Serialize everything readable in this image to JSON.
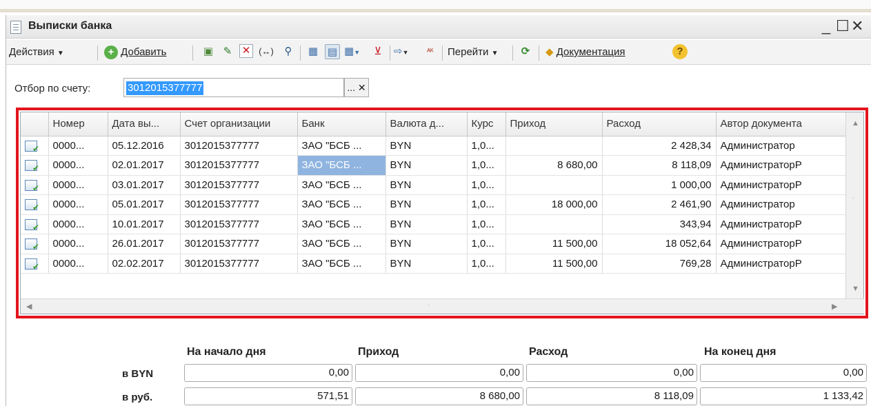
{
  "window": {
    "title": "Выписки банка",
    "controls": [
      "_",
      "☐",
      "✕"
    ]
  },
  "toolbar": {
    "actions_label": "Действия",
    "add_label": "Добавить",
    "goto_label": "Перейти",
    "docs_label": "Документация",
    "icons": [
      "copy-icon",
      "edit-icon",
      "delete-icon",
      "link-icon",
      "find-icon",
      "filter-icon",
      "filter-active-icon",
      "filter-menu-icon",
      "filter-clear-icon",
      "export-icon",
      "dt-kt-icon",
      "refresh-icon",
      "docs-icon",
      "help-icon"
    ]
  },
  "filter": {
    "label": "Отбор по счету:",
    "value": "3012015377777",
    "select_button": "...",
    "clear_button": "✕"
  },
  "table": {
    "columns": [
      "Номер",
      "Дата вы...",
      "Счет организации",
      "Банк",
      "Валюта д...",
      "Курс",
      "Приход",
      "Расход",
      "Автор документа"
    ],
    "rows": [
      {
        "number": "0000...",
        "date": "05.12.2016",
        "account": "3012015377777",
        "bank": "ЗАО \"БСБ ...",
        "currency": "BYN",
        "rate": "1,0...",
        "income": "",
        "expense": "2 428,34",
        "author": "Администратор"
      },
      {
        "number": "0000...",
        "date": "02.01.2017",
        "account": "3012015377777",
        "bank": "ЗАО \"БСБ ...",
        "currency": "BYN",
        "rate": "1,0...",
        "income": "8 680,00",
        "expense": "8 118,09",
        "author": "АдминистраторР"
      },
      {
        "number": "0000...",
        "date": "03.01.2017",
        "account": "3012015377777",
        "bank": "ЗАО \"БСБ ...",
        "currency": "BYN",
        "rate": "1,0...",
        "income": "",
        "expense": "1 000,00",
        "author": "АдминистраторР"
      },
      {
        "number": "0000...",
        "date": "05.01.2017",
        "account": "3012015377777",
        "bank": "ЗАО \"БСБ ...",
        "currency": "BYN",
        "rate": "1,0...",
        "income": "18 000,00",
        "expense": "2 461,90",
        "author": "Администратор"
      },
      {
        "number": "0000...",
        "date": "10.01.2017",
        "account": "3012015377777",
        "bank": "ЗАО \"БСБ ...",
        "currency": "BYN",
        "rate": "1,0...",
        "income": "",
        "expense": "343,94",
        "author": "АдминистраторР"
      },
      {
        "number": "0000...",
        "date": "26.01.2017",
        "account": "3012015377777",
        "bank": "ЗАО \"БСБ ...",
        "currency": "BYN",
        "rate": "1,0...",
        "income": "11 500,00",
        "expense": "18 052,64",
        "author": "АдминистраторР"
      },
      {
        "number": "0000...",
        "date": "02.02.2017",
        "account": "3012015377777",
        "bank": "ЗАО \"БСБ ...",
        "currency": "BYN",
        "rate": "1,0...",
        "income": "11 500,00",
        "expense": "769,28",
        "author": "АдминистраторР"
      }
    ],
    "selected_row": 1
  },
  "totals": {
    "headers": [
      "На начало дня",
      "Приход",
      "Расход",
      "На конец дня"
    ],
    "rows": [
      {
        "label": "в BYN",
        "values": [
          "0,00",
          "0,00",
          "0,00",
          "0,00"
        ]
      },
      {
        "label": "в руб.",
        "values": [
          "571,51",
          "8 680,00",
          "8 118,09",
          "1 133,42"
        ]
      }
    ]
  },
  "colors": {
    "highlight_frame": "#e3141c",
    "selection": "#3399ff",
    "current_cell": "#8fb4e0"
  }
}
